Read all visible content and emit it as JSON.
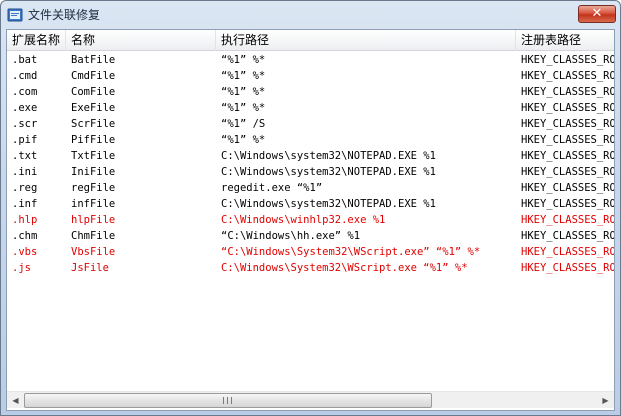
{
  "window": {
    "title": "文件关联修复",
    "close_label": "✕"
  },
  "columns": [
    "扩展名称",
    "名称",
    "执行路径",
    "注册表路径"
  ],
  "rows": [
    {
      "ext": ".bat",
      "name": "BatFile",
      "path": "“%1” %*",
      "reg": "HKEY_CLASSES_ROO",
      "highlight": false
    },
    {
      "ext": ".cmd",
      "name": "CmdFile",
      "path": "“%1” %*",
      "reg": "HKEY_CLASSES_ROO",
      "highlight": false
    },
    {
      "ext": ".com",
      "name": "ComFile",
      "path": "“%1” %*",
      "reg": "HKEY_CLASSES_ROO",
      "highlight": false
    },
    {
      "ext": ".exe",
      "name": "ExeFile",
      "path": "“%1” %*",
      "reg": "HKEY_CLASSES_ROO",
      "highlight": false
    },
    {
      "ext": ".scr",
      "name": "ScrFile",
      "path": "“%1” /S",
      "reg": "HKEY_CLASSES_ROO",
      "highlight": false
    },
    {
      "ext": ".pif",
      "name": "PifFile",
      "path": "“%1” %*",
      "reg": "HKEY_CLASSES_ROO",
      "highlight": false
    },
    {
      "ext": ".txt",
      "name": "TxtFile",
      "path": "C:\\Windows\\system32\\NOTEPAD.EXE %1",
      "reg": "HKEY_CLASSES_ROO",
      "highlight": false
    },
    {
      "ext": ".ini",
      "name": "IniFile",
      "path": "C:\\Windows\\system32\\NOTEPAD.EXE %1",
      "reg": "HKEY_CLASSES_ROO",
      "highlight": false
    },
    {
      "ext": ".reg",
      "name": "regFile",
      "path": "regedit.exe “%1”",
      "reg": "HKEY_CLASSES_ROO",
      "highlight": false
    },
    {
      "ext": ".inf",
      "name": "infFile",
      "path": "C:\\Windows\\system32\\NOTEPAD.EXE %1",
      "reg": "HKEY_CLASSES_ROO",
      "highlight": false
    },
    {
      "ext": ".hlp",
      "name": "hlpFile",
      "path": "C:\\Windows\\winhlp32.exe %1",
      "reg": "HKEY_CLASSES_ROO",
      "highlight": true
    },
    {
      "ext": ".chm",
      "name": "ChmFile",
      "path": "“C:\\Windows\\hh.exe” %1",
      "reg": "HKEY_CLASSES_ROO",
      "highlight": false
    },
    {
      "ext": ".vbs",
      "name": "VbsFile",
      "path": "“C:\\Windows\\System32\\WScript.exe” “%1” %*",
      "reg": "HKEY_CLASSES_ROO",
      "highlight": true
    },
    {
      "ext": ".js",
      "name": "JsFile",
      "path": "C:\\Windows\\System32\\WScript.exe “%1” %*",
      "reg": "HKEY_CLASSES_ROO",
      "highlight": true
    }
  ],
  "colors": {
    "highlight_text": "#e00000",
    "normal_text": "#000000"
  },
  "icons": {
    "app": "app-icon",
    "scroll_left": "scroll-left-arrow-icon",
    "scroll_right": "scroll-right-arrow-icon"
  }
}
